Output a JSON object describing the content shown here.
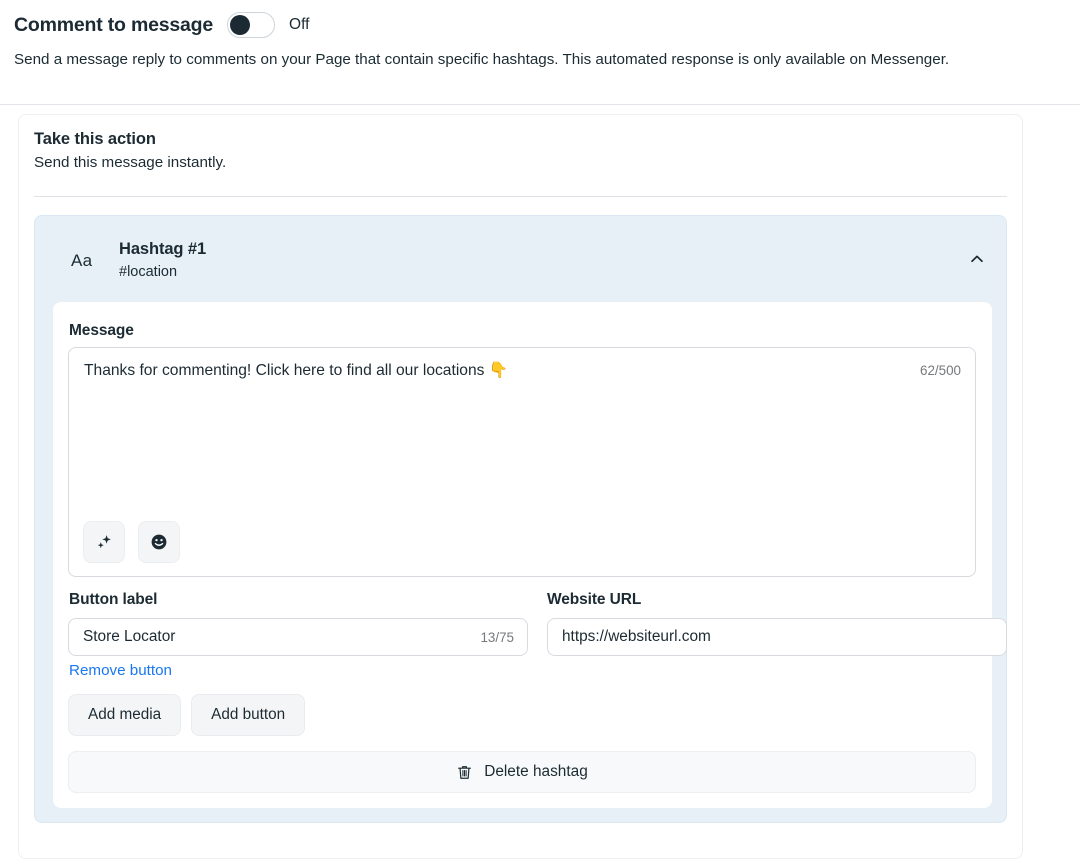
{
  "header": {
    "title": "Comment to message",
    "toggle": {
      "name": "comment-to-message-toggle",
      "state_label": "Off",
      "checked": false
    },
    "description": "Send a message reply to comments on your Page that contain specific hashtags. This automated response is only available on Messenger."
  },
  "action_section": {
    "title": "Take this action",
    "subtitle": "Send this message instantly."
  },
  "hashtag_card": {
    "icon_label": "Aa",
    "name": "Hashtag #1",
    "tag": "#location",
    "collapse_icon": "chevron-up-icon",
    "message": {
      "label": "Message",
      "value": "Thanks for commenting! Click here to find all our locations 👇",
      "counter": "62/500",
      "tools": [
        {
          "icon": "sparkles-icon",
          "glyph": "✦"
        },
        {
          "icon": "emoji-smiley-icon",
          "glyph": "☻"
        }
      ]
    },
    "button_label": {
      "label": "Button label",
      "value": "Store Locator",
      "counter": "13/75"
    },
    "website_url": {
      "label": "Website URL",
      "value": "https://websiteurl.com"
    },
    "remove_button_link": "Remove button",
    "actions": [
      {
        "label": "Add media"
      },
      {
        "label": "Add button"
      }
    ],
    "delete": {
      "label": "Delete hashtag",
      "icon": "trash-icon"
    }
  },
  "colors": {
    "accent_link": "#1877f2",
    "card_blue": "#e7eff7",
    "text_primary": "#1c2b33",
    "text_muted": "#76797c",
    "border": "#d7dbe0"
  }
}
